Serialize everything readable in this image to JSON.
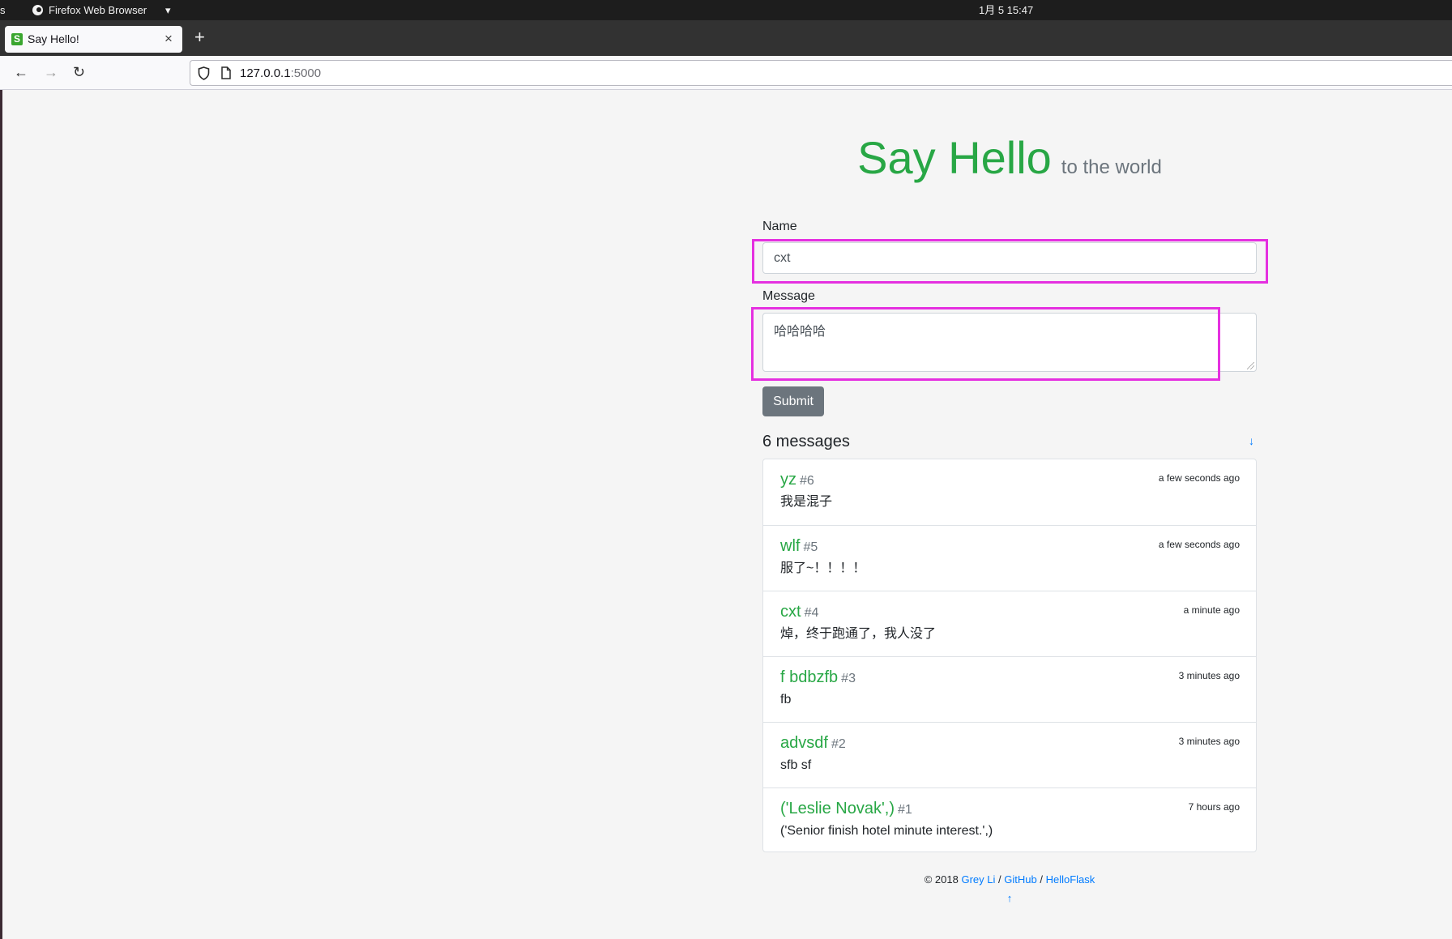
{
  "system_bar": {
    "activities": "s",
    "app_name": "Firefox Web Browser",
    "menu_arrow": "▾",
    "clock": "1月 5  15:47"
  },
  "browser": {
    "tab": {
      "favicon": "S",
      "title": "Say Hello!",
      "close": "×"
    },
    "new_tab": "+",
    "nav": {
      "back": "←",
      "forward": "→",
      "reload": "↻"
    },
    "url": {
      "host": "127.0.0.1",
      "port": ":5000"
    }
  },
  "page": {
    "title": "Say Hello",
    "subtitle": "to the world",
    "form": {
      "name_label": "Name",
      "name_value": "cxt",
      "message_label": "Message",
      "message_value": "哈哈哈哈",
      "submit_label": "Submit"
    },
    "messages_header": "6 messages",
    "scroll_down": "↓",
    "messages": [
      {
        "name": "yz",
        "number": "#6",
        "body": "我是混子",
        "time": "a few seconds ago"
      },
      {
        "name": "wlf",
        "number": "#5",
        "body": "服了~！！！！",
        "time": "a few seconds ago"
      },
      {
        "name": "cxt",
        "number": "#4",
        "body": "焯，终于跑通了，我人没了",
        "time": "a minute ago"
      },
      {
        "name": "f bdbzfb",
        "number": "#3",
        "body": "fb",
        "time": "3 minutes ago"
      },
      {
        "name": "advsdf",
        "number": "#2",
        "body": "sfb sf",
        "time": "3 minutes ago"
      },
      {
        "name": "('Leslie Novak',)",
        "number": "#1",
        "body": "('Senior finish hotel minute interest.',)",
        "time": "7 hours ago"
      }
    ],
    "footer": {
      "copyright": "© 2018",
      "author": "Grey Li",
      "sep": "/",
      "github": "GitHub",
      "helloflask": "HelloFlask",
      "scroll_up": "↑"
    }
  },
  "colors": {
    "brand_green": "#28a745",
    "muted": "#6c757d",
    "link": "#007bff",
    "annotation": "#e530e0"
  },
  "icons": {
    "firefox": "firefox-logo-icon",
    "shield": "tracking-protection-shield-icon",
    "page": "page-info-icon"
  }
}
